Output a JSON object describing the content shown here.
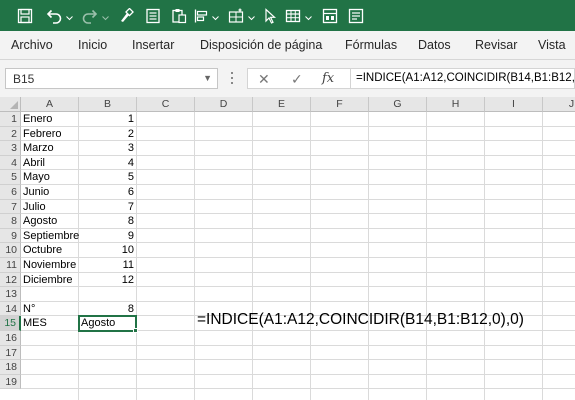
{
  "theme": {
    "accent": "#217346",
    "ribbon_bg": "#f3f3f3",
    "header_bg": "#e6e6e6"
  },
  "toolbar_icons": [
    "save-icon",
    "undo-icon",
    "redo-icon",
    "format-painter-icon",
    "form-icon",
    "paste-values-icon",
    "align-icon",
    "insert-cells-icon",
    "select-objects-icon",
    "table-icon",
    "filter-icon",
    "customize-icon"
  ],
  "ribbon": {
    "tabs": [
      "Archivo",
      "Inicio",
      "Insertar",
      "Disposición de página",
      "Fórmulas",
      "Datos",
      "Revisar",
      "Vista"
    ]
  },
  "formula_bar": {
    "name_box": "B15",
    "cancel_glyph": "✕",
    "enter_glyph": "✓",
    "fx_label": "fx",
    "formula": "=INDICE(A1:A12,COINCIDIR(B14,B1:B12,0),0)"
  },
  "grid": {
    "columns": [
      "A",
      "B",
      "C",
      "D",
      "E",
      "F",
      "G",
      "H",
      "I",
      "J"
    ],
    "rows": [
      "1",
      "2",
      "3",
      "4",
      "5",
      "6",
      "7",
      "8",
      "9",
      "10",
      "11",
      "12",
      "13",
      "14",
      "15",
      "16",
      "17",
      "18",
      "19"
    ],
    "selected_row": "15",
    "cells": {
      "A": [
        "Enero",
        "Febrero",
        "Marzo",
        "Abril",
        "Mayo",
        "Junio",
        "Julio",
        "Agosto",
        "Septiembre",
        "Octubre",
        "Noviembre",
        "Diciembre",
        "",
        "N°",
        "MES"
      ],
      "B": [
        "1",
        "2",
        "3",
        "4",
        "5",
        "6",
        "7",
        "8",
        "9",
        "10",
        "11",
        "12",
        "",
        "8",
        "Agosto"
      ]
    },
    "overlay_formula": "=INDICE(A1:A12,COINCIDIR(B14,B1:B12,0),0)"
  }
}
